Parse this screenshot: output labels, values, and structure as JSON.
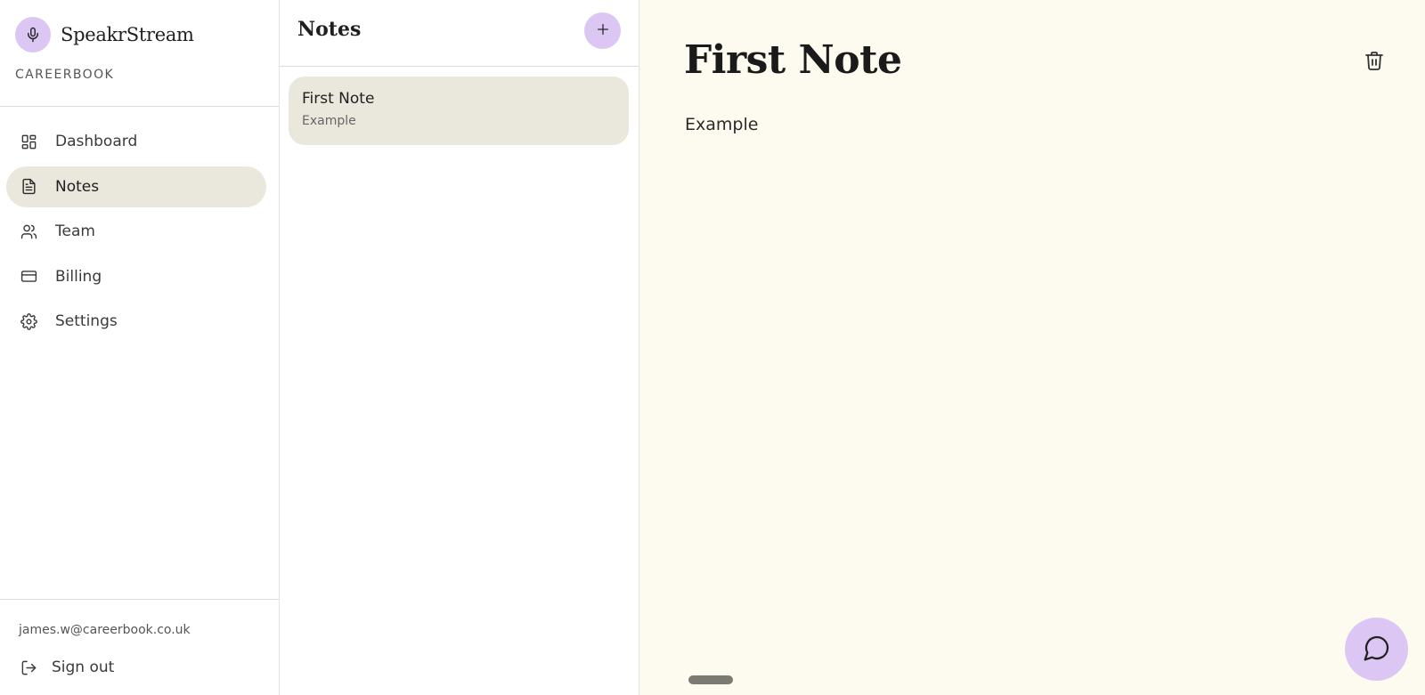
{
  "brand": {
    "name": "SpeakrStream",
    "logo_icon": "microphone-icon",
    "accent": "#dcc6f3"
  },
  "org": {
    "name": "CAREERBOOK"
  },
  "sidebar": {
    "items": [
      {
        "label": "Dashboard",
        "icon": "dashboard-icon",
        "active": false
      },
      {
        "label": "Notes",
        "icon": "document-icon",
        "active": true
      },
      {
        "label": "Team",
        "icon": "users-icon",
        "active": false
      },
      {
        "label": "Billing",
        "icon": "credit-card-icon",
        "active": false
      },
      {
        "label": "Settings",
        "icon": "gear-icon",
        "active": false
      }
    ],
    "user_email": "james.w@careerbook.co.uk",
    "signout_label": "Sign out"
  },
  "notes_panel": {
    "title": "Notes",
    "add_icon": "plus-icon",
    "notes": [
      {
        "title": "First Note",
        "preview": "Example",
        "selected": true
      }
    ]
  },
  "editor": {
    "title": "First Note",
    "body": "Example",
    "delete_icon": "trash-icon",
    "chat_icon": "chat-bubble-icon"
  },
  "colors": {
    "active_bg": "#eae7dc",
    "editor_bg": "#fdfbef"
  }
}
